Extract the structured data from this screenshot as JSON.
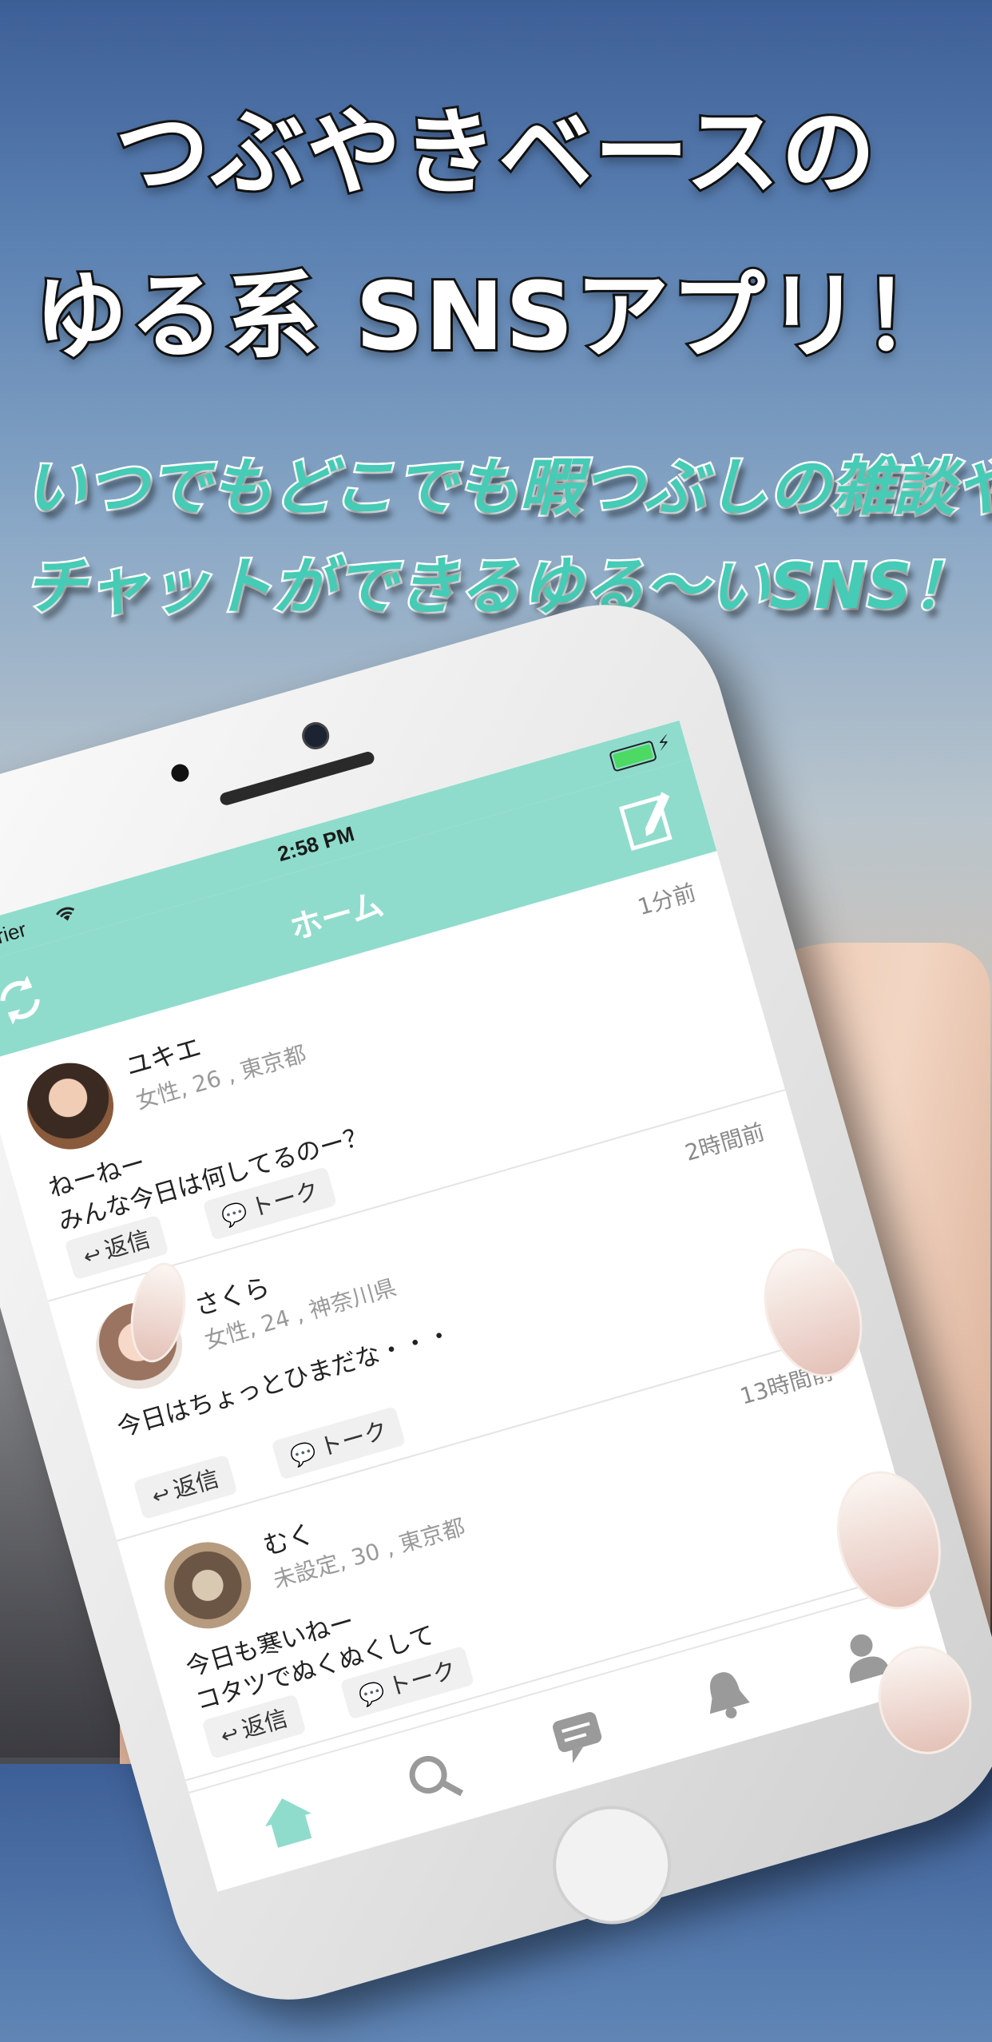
{
  "headline": {
    "line1": "つぶやきベースの",
    "line2": "ゆる系 SNSアプリ！"
  },
  "subheadline": {
    "line1": "いつでもどこでも暇つぶしの雑談や",
    "line2": "チャットができるゆる〜いSNS！"
  },
  "status_bar": {
    "carrier": "Carrier",
    "time": "2:58 PM"
  },
  "nav": {
    "title": "ホーム",
    "left_icon": "refresh-icon",
    "right_icon": "compose-icon"
  },
  "posts": [
    {
      "name": "ユキエ",
      "meta": "女性, 26 , 東京都",
      "time_ago": "1分前",
      "text": "ねーねー\nみんな今日は何してるのー？",
      "reply_label": "返信",
      "talk_label": "トーク"
    },
    {
      "name": "さくら",
      "meta": "女性, 24 , 神奈川県",
      "time_ago": "2時間前",
      "text": "今日はちょっとひまだな・・・",
      "reply_label": "返信",
      "talk_label": "トーク"
    },
    {
      "name": "むく",
      "meta": "未設定, 30 , 東京都",
      "time_ago": "13時間前",
      "text": "今日も寒いねー\nコタツでぬくぬくして",
      "reply_label": "返信",
      "talk_label": "トーク"
    }
  ],
  "tabbar": {
    "items": [
      "home-icon",
      "search-icon",
      "chat-icon",
      "bell-icon",
      "person-icon"
    ]
  },
  "colors": {
    "accent": "#8fdccc",
    "subheadline": "#45cbb6"
  }
}
